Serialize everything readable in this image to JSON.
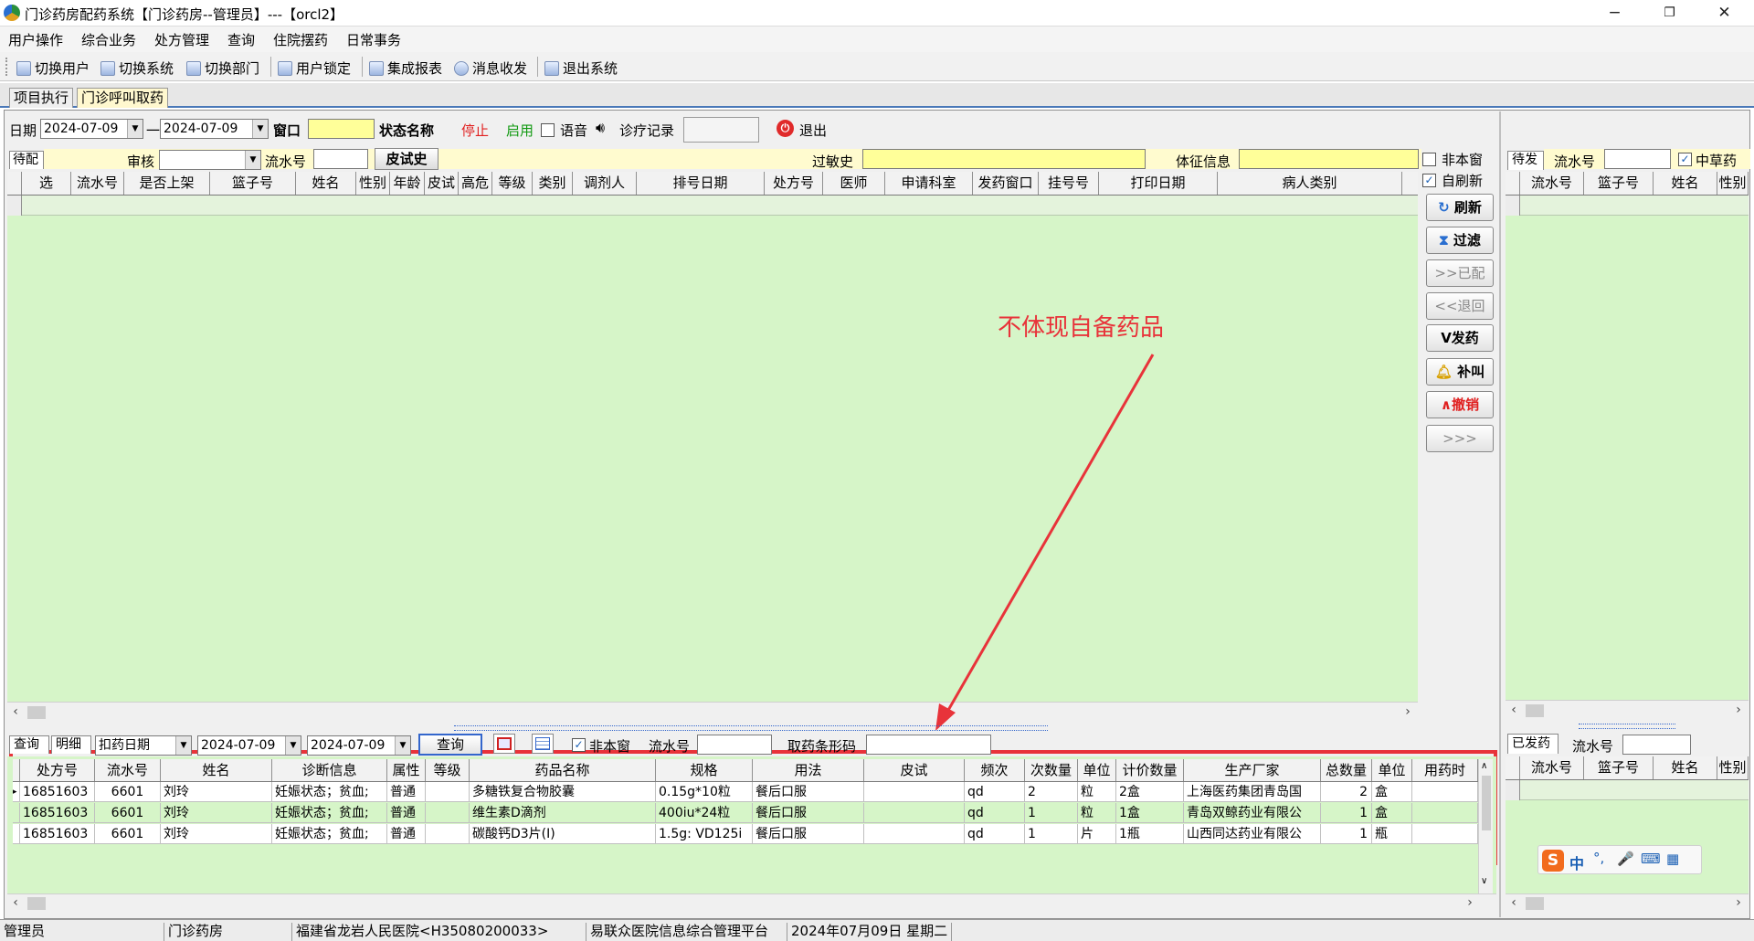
{
  "window": {
    "title": "门诊药房配药系统【门诊药房--管理员】---【orcl2】",
    "min": "−",
    "restore": "❐",
    "close": "✕"
  },
  "menu": [
    "用户操作",
    "综合业务",
    "处方管理",
    "查询",
    "住院摆药",
    "日常事务"
  ],
  "toolbar": [
    "切换用户",
    "切换系统",
    "切换部门",
    "用户锁定",
    "集成报表",
    "消息收发",
    "退出系统"
  ],
  "tabs": [
    "项目执行",
    "门诊呼叫取药"
  ],
  "filter": {
    "date_label": "日期",
    "date_from": "2024-07-09",
    "dash": "一",
    "date_to": "2024-07-09",
    "window_label": "窗口",
    "window_value": "",
    "status_label": "状态名称",
    "stop": "停止",
    "enable": "启用",
    "voice": "语音",
    "records": "诊疗记录",
    "exit": "退出"
  },
  "row2": {
    "pending": "待配",
    "audit_label": "审核",
    "serial_label": "流水号",
    "skin_btn": "皮试史",
    "allergy_label": "过敏史",
    "sign_label": "体征信息"
  },
  "main_grid": {
    "headers": [
      "选",
      "流水号",
      "是否上架",
      "篮子号",
      "姓名",
      "性别",
      "年龄",
      "皮试",
      "高危",
      "等级",
      "类别",
      "调剂人",
      "排号日期",
      "处方号",
      "医师",
      "申请科室",
      "发药窗口",
      "挂号号",
      "打印日期",
      "病人类别"
    ]
  },
  "side": {
    "not_window": "非本窗",
    "auto_refresh": "自刷新",
    "buttons": [
      "刷新",
      "过滤",
      ">>已配",
      "<<退回",
      "V发药",
      "补叫",
      "∧撤销",
      ">>>"
    ]
  },
  "annotation": {
    "text": "不体现自备药品",
    "color": "#e8333a"
  },
  "bottom_filter": {
    "tab_query": "查询",
    "tab_detail": "明细",
    "date_type": "扣药日期",
    "date_from": "2024-07-09",
    "date_to": "2024-07-09",
    "query_btn": "查询",
    "not_window": "非本窗",
    "serial_label": "流水号",
    "barcode_label": "取药条形码"
  },
  "detail": {
    "headers": [
      "处方号",
      "流水号",
      "姓名",
      "诊断信息",
      "属性",
      "等级",
      "药品名称",
      "规格",
      "用法",
      "皮试",
      "频次",
      "次数量",
      "单位",
      "计价数量",
      "生产厂家",
      "总数量",
      "单位",
      "用药时"
    ],
    "rows": [
      [
        "16851603",
        "6601",
        "刘玲",
        "妊娠状态；贫血;",
        "普通",
        "",
        "多糖铁复合物胶囊",
        "0.15g*10粒",
        "餐后口服",
        "",
        "qd",
        "2",
        "粒",
        "2盒",
        "上海医药集团青岛国",
        "2",
        "盒",
        ""
      ],
      [
        "16851603",
        "6601",
        "刘玲",
        "妊娠状态；贫血;",
        "普通",
        "",
        "维生素D滴剂",
        "400iu*24粒",
        "餐后口服",
        "",
        "qd",
        "1",
        "粒",
        "1盒",
        "青岛双鲸药业有限公",
        "1",
        "盒",
        ""
      ],
      [
        "16851603",
        "6601",
        "刘玲",
        "妊娠状态；贫血;",
        "普通",
        "",
        "碳酸钙D3片(Ⅰ)",
        "1.5g: VD125i",
        "餐后口服",
        "",
        "qd",
        "1",
        "片",
        "1瓶",
        "山西同达药业有限公",
        "1",
        "瓶",
        ""
      ]
    ]
  },
  "right_top": {
    "tab": "待发",
    "serial_label": "流水号",
    "herbal": "中草药",
    "headers": [
      "流水号",
      "篮子号",
      "姓名",
      "性别"
    ]
  },
  "right_bottom": {
    "tab": "已发药",
    "serial_label": "流水号",
    "headers": [
      "流水号",
      "篮子号",
      "姓名",
      "性别"
    ]
  },
  "ime": {
    "logo": "S",
    "items": [
      "中",
      "°,",
      "🎤",
      "⌨",
      "▦"
    ]
  },
  "status": [
    "管理员",
    "门诊药房",
    "福建省龙岩人民医院<H35080200033>",
    "易联众医院信息综合管理平台",
    "2024年07月09日 星期二"
  ]
}
